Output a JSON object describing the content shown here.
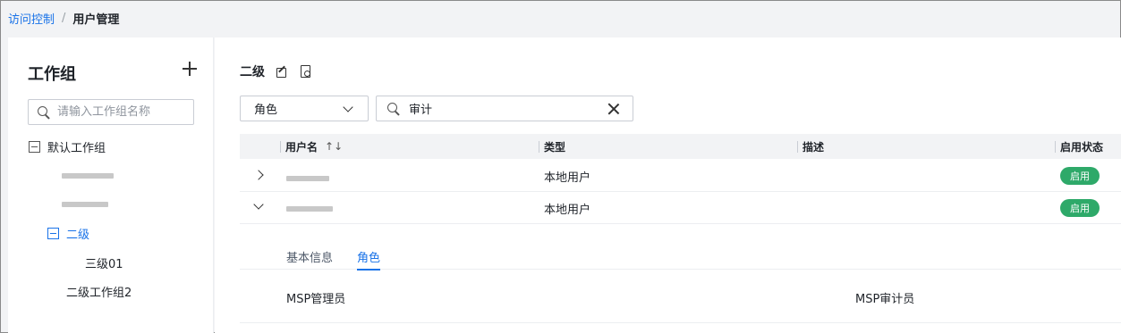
{
  "breadcrumb": {
    "parent": "访问控制",
    "separator": "/",
    "current": "用户管理"
  },
  "sidebar": {
    "title": "工作组",
    "search_placeholder": "请输入工作组名称",
    "tree": {
      "root": "默认工作组",
      "selected": "二级",
      "child_of_selected": "三级01",
      "sibling": "二级工作组2"
    }
  },
  "main": {
    "group_title": "二级",
    "filter": {
      "field": "角色",
      "search_value": "审计"
    },
    "table": {
      "columns": [
        "用户名",
        "类型",
        "描述",
        "启用状态"
      ],
      "sort_icon": "↑↓",
      "rows": [
        {
          "type": "本地用户",
          "description": "",
          "status": "启用",
          "expanded": false
        },
        {
          "type": "本地用户",
          "description": "",
          "status": "启用",
          "expanded": true
        }
      ]
    },
    "detail": {
      "tabs": [
        "基本信息",
        "角色"
      ],
      "active_tab": "角色",
      "roles": [
        "MSP管理员",
        "MSP审计员"
      ]
    }
  },
  "colors": {
    "accent": "#1a73e8",
    "status_enabled": "#2ea969"
  }
}
